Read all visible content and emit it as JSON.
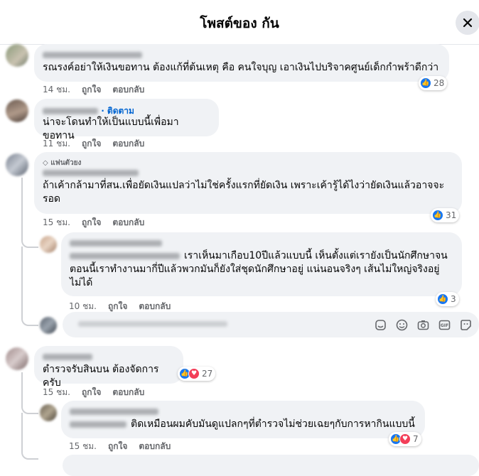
{
  "header": {
    "title": "โพสต์ของ กัน",
    "close_icon": "close-icon"
  },
  "comments": [
    {
      "text": "รณรงค์อย่าให้เงินขอทาน ต้องแก้ที่ต้นเหตุ คือ คนใจบุญ เอาเงินไปบริจาคศูนย์เด็กกำพร้าดีกว่า",
      "time": "14 ชม.",
      "like": "ถูกใจ",
      "reply": "ตอบกลับ",
      "reactions": "28"
    },
    {
      "follow": "· ติดตาม",
      "text": "น่าจะโดนทำให้เป็นแบบนี้เพื่อมาขอทาน",
      "time": "11 ชม.",
      "like": "ถูกใจ",
      "reply": "ตอบกลับ"
    },
    {
      "badge": "แฟนตัวยง",
      "text_line1": "ถ้าเค้ากล้ามาที่สน.เพื่อยัดเงินแปลว่าไม่ใช่ครั้งแรกที่ยัดเงิน เพราะเค้ารู้ได้ไงว่ายัดเงินแล้วอาจจะ",
      "text_line2": "รอด",
      "time": "15 ชม.",
      "like": "ถูกใจ",
      "reply": "ตอบกลับ",
      "reactions": "31"
    },
    {
      "text_line1": "เราเห็นมาเกือบ10ปีแล้วแบบนี้ เห็นตั้งแต่เรายังเป็นนักศึกษาจน",
      "text_line2": "ตอนนี้เราทำงานมากี่ปีแล้วพวกมันก็ยังใส่ชุดนักศึกษาอยู่ แน่นอนจริงๆ เส้นไม่ใหญ่จริงอยู่",
      "text_line3": "ไม่ได้",
      "time": "10 ชม.",
      "like": "ถูกใจ",
      "reply": "ตอบกลับ",
      "reactions": "3"
    },
    {
      "text": "ตำรวจรับสินบน ต้องจัดการครับ",
      "time": "15 ชม.",
      "like": "ถูกใจ",
      "reply": "ตอบกลับ",
      "reactions": "27"
    },
    {
      "text": "ติดเหมือนผมคับมันดูแปลกๆที่ตำรวจไม่ช่วยเฉยๆกับการหากินแบบนี้",
      "time": "15 ชม.",
      "like": "ถูกใจ",
      "reply": "ตอบกลับ",
      "reactions": "7"
    }
  ],
  "input_icons": [
    "sticker-icon",
    "emoji-icon",
    "camera-icon",
    "gif-icon",
    "avatar-sticker-icon"
  ]
}
